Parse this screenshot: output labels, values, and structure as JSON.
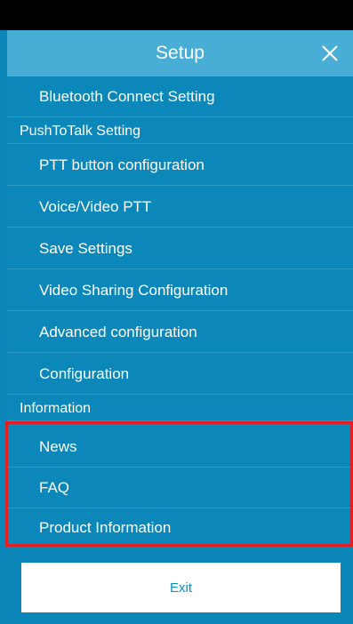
{
  "header": {
    "title": "Setup"
  },
  "menu": {
    "bluetooth": "Bluetooth Connect Setting",
    "section_ptt": "PushToTalk Setting",
    "ptt_button": "PTT button configuration",
    "voice_video": "Voice/Video PTT",
    "save_settings": "Save Settings",
    "video_sharing": "Video Sharing Configuration",
    "advanced": "Advanced configuration",
    "configuration": "Configuration",
    "section_info": "Information",
    "news": "News",
    "faq": "FAQ",
    "product_info": "Product Information"
  },
  "footer": {
    "exit_label": "Exit"
  },
  "colors": {
    "background": "#0a87b8",
    "header": "#49aed5",
    "highlight": "#e01e24"
  },
  "icons": {
    "close": "close-icon"
  }
}
